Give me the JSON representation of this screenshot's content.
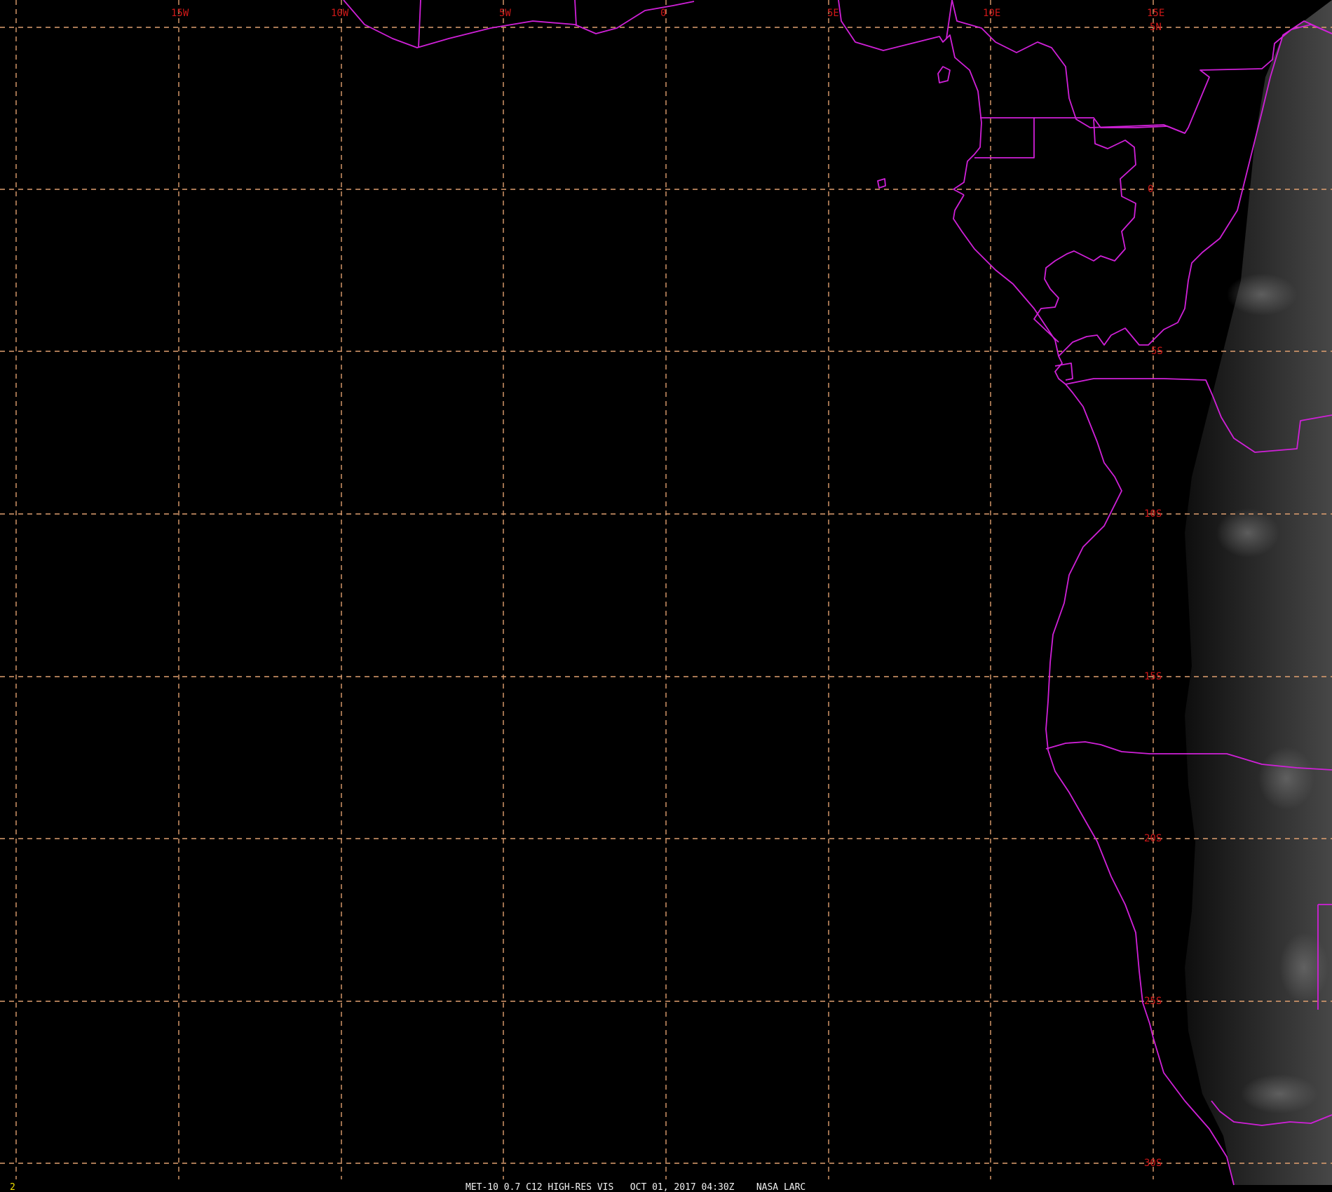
{
  "map": {
    "longitude_labels": [
      "15W",
      "10W",
      "5W",
      "0",
      "5E",
      "10E",
      "15E"
    ],
    "latitude_labels": [
      "5N",
      "0",
      "5S",
      "10S",
      "15S",
      "20S",
      "25S",
      "30S"
    ]
  },
  "status_bar": {
    "frame_number": "2",
    "caption": "MET-10 0.7 C12 HIGH-RES VIS   OCT 01, 2017 04:30Z    NASA LARC"
  },
  "colors": {
    "background": "#000000",
    "grid": "#e0a070",
    "coastline": "#d020d8",
    "labels": "#d01818",
    "caption": "#f2f2f2",
    "frame_number": "#f0e000"
  }
}
